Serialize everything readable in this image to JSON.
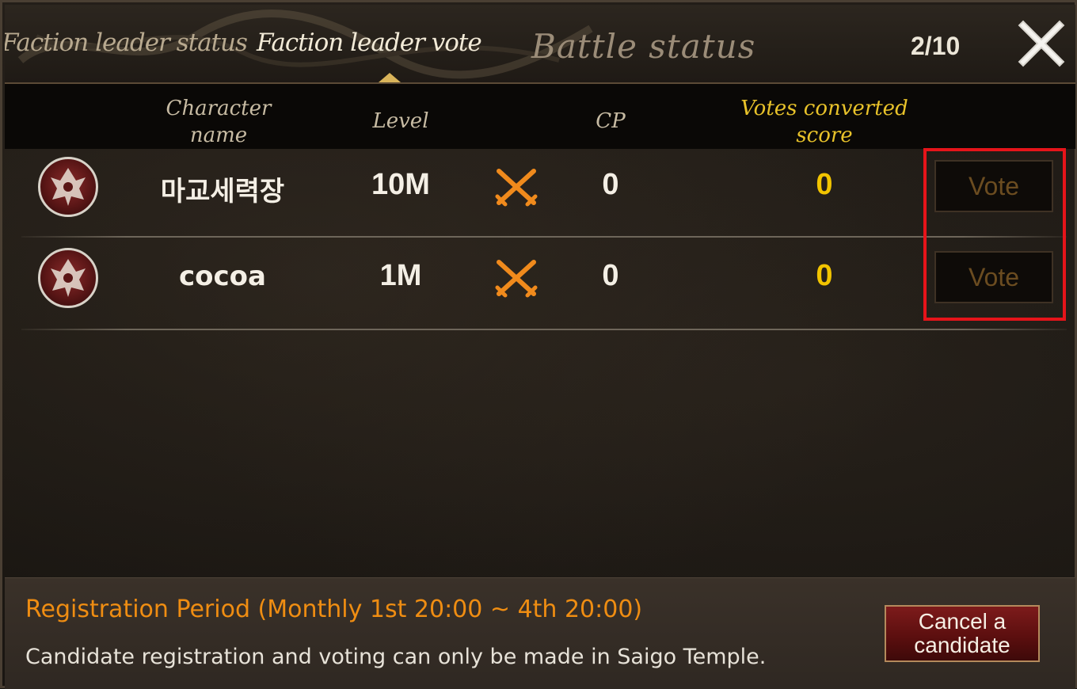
{
  "tabs": [
    {
      "label": "Faction leader status"
    },
    {
      "label": "Faction leader vote"
    },
    {
      "label": "Battle status"
    }
  ],
  "page_indicator": "2/10",
  "icons": {
    "close": "close-icon",
    "avatar": "faction-emblem-icon",
    "swords": "crossed-swords-icon"
  },
  "columns": {
    "name_line1": "Character",
    "name_line2": "name",
    "level": "Level",
    "cp": "CP",
    "score_line1": "Votes converted",
    "score_line2": "score"
  },
  "rows": [
    {
      "name": "마교세력장",
      "level": "10M",
      "cp": "0",
      "score": "0",
      "vote_label": "Vote"
    },
    {
      "name": "cocoa",
      "level": "1M",
      "cp": "0",
      "score": "0",
      "vote_label": "Vote"
    }
  ],
  "footer": {
    "period": "Registration Period (Monthly 1st 20:00 ~ 4th 20:00)",
    "notice": "Candidate registration and voting can only be made in Saigo Temple.",
    "cancel_line1": "Cancel a",
    "cancel_line2": "candidate"
  },
  "colors": {
    "score": "#f2c400",
    "period": "#ef8d12",
    "highlight": "#e6141a",
    "swords": "#f08a1c"
  }
}
